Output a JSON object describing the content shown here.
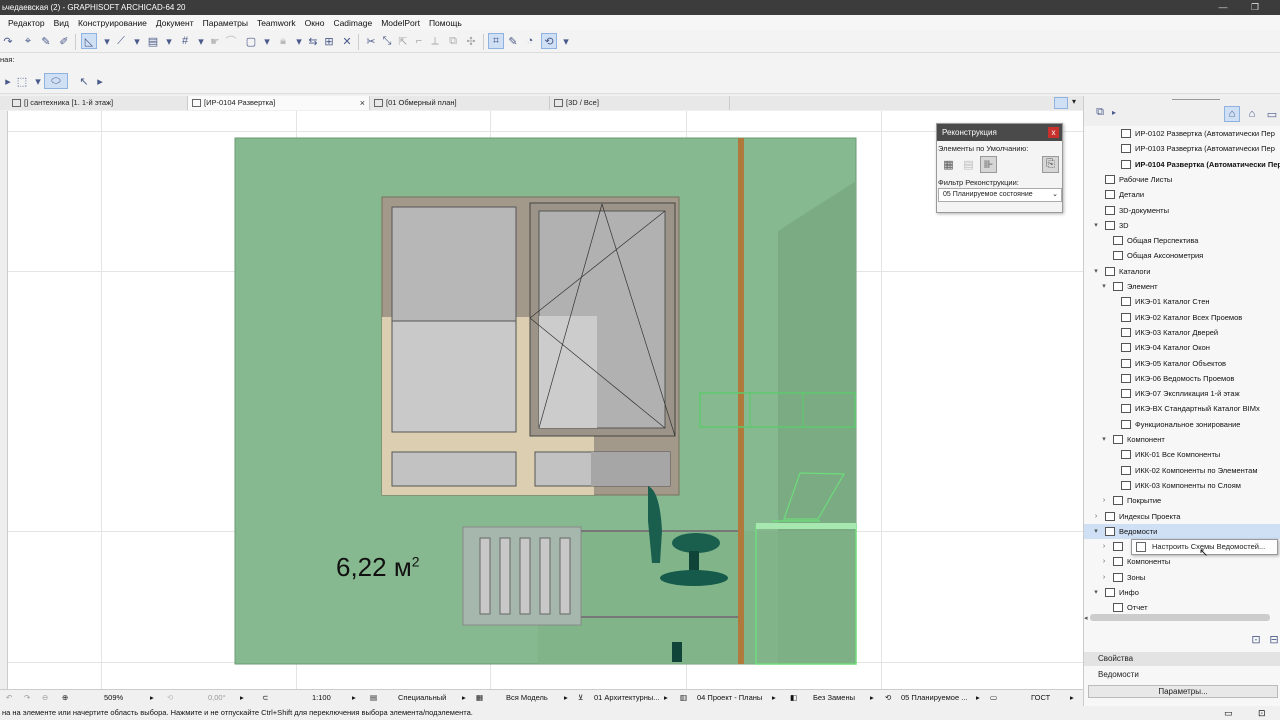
{
  "window": {
    "title": "ьчедаевская (2) - GRAPHISOFT ARCHICAD-64 20"
  },
  "menu": [
    "Редактор",
    "Вид",
    "Конструирование",
    "Документ",
    "Параметры",
    "Teamwork",
    "Окно",
    "Cadimage",
    "ModelPort",
    "Помощь"
  ],
  "toolbar2": {
    "label": "ная:"
  },
  "tabs": [
    {
      "label": "[] сантехника [1. 1-й этаж]",
      "active": false
    },
    {
      "label": "[ИР-0104 Развертка]",
      "active": true
    },
    {
      "label": "[01 Обмерный план]",
      "active": false
    },
    {
      "label": "[3D / Все]",
      "active": false
    }
  ],
  "canvas": {
    "area_label": "6,22 м",
    "area_sup": "2",
    "colors": {
      "wall": "#87b990",
      "frame": "#a3998a",
      "pipe": "#b07a3c",
      "chair": "#1a5f4e"
    }
  },
  "reconstruction": {
    "title": "Реконструкция",
    "close": "x",
    "defaults_label": "Элементы по Умолчанию:",
    "filter_label": "Фильтр Реконструкции:",
    "filter_value": "05 Планируемое состояние"
  },
  "navigator": {
    "rows": [
      {
        "label": "ИР-0102 Развертка (Автоматически Пер",
        "indent": 3,
        "arrow": "",
        "bold": false,
        "sel": false
      },
      {
        "label": "ИР-0103 Развертка (Автоматически Пер",
        "indent": 3,
        "arrow": "",
        "bold": false,
        "sel": false
      },
      {
        "label": "ИР-0104 Развертка (Автоматически Пер",
        "indent": 3,
        "arrow": "",
        "bold": true,
        "sel": false
      },
      {
        "label": "Рабочие Листы",
        "indent": 1,
        "arrow": "",
        "bold": false,
        "sel": false
      },
      {
        "label": "Детали",
        "indent": 1,
        "arrow": "",
        "bold": false,
        "sel": false
      },
      {
        "label": "3D-документы",
        "indent": 1,
        "arrow": "",
        "bold": false,
        "sel": false
      },
      {
        "label": "3D",
        "indent": 1,
        "arrow": "▾",
        "bold": false,
        "sel": false
      },
      {
        "label": "Общая Перспектива",
        "indent": 2,
        "arrow": "",
        "bold": false,
        "sel": false
      },
      {
        "label": "Общая Аксонометрия",
        "indent": 2,
        "arrow": "",
        "bold": false,
        "sel": false
      },
      {
        "label": "Каталоги",
        "indent": 1,
        "arrow": "▾",
        "bold": false,
        "sel": false
      },
      {
        "label": "Элемент",
        "indent": 2,
        "arrow": "▾",
        "bold": false,
        "sel": false
      },
      {
        "label": "ИКЭ-01 Каталог Стен",
        "indent": 3,
        "arrow": "",
        "bold": false,
        "sel": false
      },
      {
        "label": "ИКЭ-02 Каталог Всех Проемов",
        "indent": 3,
        "arrow": "",
        "bold": false,
        "sel": false
      },
      {
        "label": "ИКЭ-03 Каталог Дверей",
        "indent": 3,
        "arrow": "",
        "bold": false,
        "sel": false
      },
      {
        "label": "ИКЭ-04 Каталог Окон",
        "indent": 3,
        "arrow": "",
        "bold": false,
        "sel": false
      },
      {
        "label": "ИКЭ-05 Каталог Объектов",
        "indent": 3,
        "arrow": "",
        "bold": false,
        "sel": false
      },
      {
        "label": "ИКЭ-06 Ведомость Проемов",
        "indent": 3,
        "arrow": "",
        "bold": false,
        "sel": false
      },
      {
        "label": "ИКЭ-07 Экспликация 1-й этаж",
        "indent": 3,
        "arrow": "",
        "bold": false,
        "sel": false
      },
      {
        "label": "ИКЭ-ВХ Стандартный Каталог BIMx",
        "indent": 3,
        "arrow": "",
        "bold": false,
        "sel": false
      },
      {
        "label": "Функциональное зонирование",
        "indent": 3,
        "arrow": "",
        "bold": false,
        "sel": false
      },
      {
        "label": "Компонент",
        "indent": 2,
        "arrow": "▾",
        "bold": false,
        "sel": false
      },
      {
        "label": "ИКК-01 Все Компоненты",
        "indent": 3,
        "arrow": "",
        "bold": false,
        "sel": false
      },
      {
        "label": "ИКК-02 Компоненты по Элементам",
        "indent": 3,
        "arrow": "",
        "bold": false,
        "sel": false
      },
      {
        "label": "ИКК-03 Компоненты по Слоям",
        "indent": 3,
        "arrow": "",
        "bold": false,
        "sel": false
      },
      {
        "label": "Покрытие",
        "indent": 2,
        "arrow": "›",
        "bold": false,
        "sel": false
      },
      {
        "label": "Индексы Проекта",
        "indent": 1,
        "arrow": "›",
        "bold": false,
        "sel": false
      },
      {
        "label": "Ведомости",
        "indent": 1,
        "arrow": "▾",
        "bold": false,
        "sel": true
      },
      {
        "label": "",
        "indent": 2,
        "arrow": "›",
        "bold": false,
        "sel": false
      },
      {
        "label": "Компоненты",
        "indent": 2,
        "arrow": "›",
        "bold": false,
        "sel": false
      },
      {
        "label": "Зоны",
        "indent": 2,
        "arrow": "›",
        "bold": false,
        "sel": false
      },
      {
        "label": "Инфо",
        "indent": 1,
        "arrow": "▾",
        "bold": false,
        "sel": false
      },
      {
        "label": "Отчет",
        "indent": 2,
        "arrow": "",
        "bold": false,
        "sel": false
      }
    ],
    "context_menu": "Настроить Схемы Ведомостей..."
  },
  "properties": {
    "section": "Свойства",
    "item": "Ведомости",
    "button": "Параметры..."
  },
  "status": {
    "zoom": "509%",
    "angle": "0,00°",
    "scale": "1:100",
    "structure": "Специальный",
    "model": "Вся Модель",
    "layers": "01 Архитектурны...",
    "pen": "04 Проект - Планы",
    "override": "Без Замены",
    "reno": "05 Планируемое ...",
    "dim": "ГОСТ"
  },
  "hint": "на на элементе или начертите область выбора. Нажмите и не отпускайте Ctrl+Shift для переключения выбора элемента/подэлемента."
}
